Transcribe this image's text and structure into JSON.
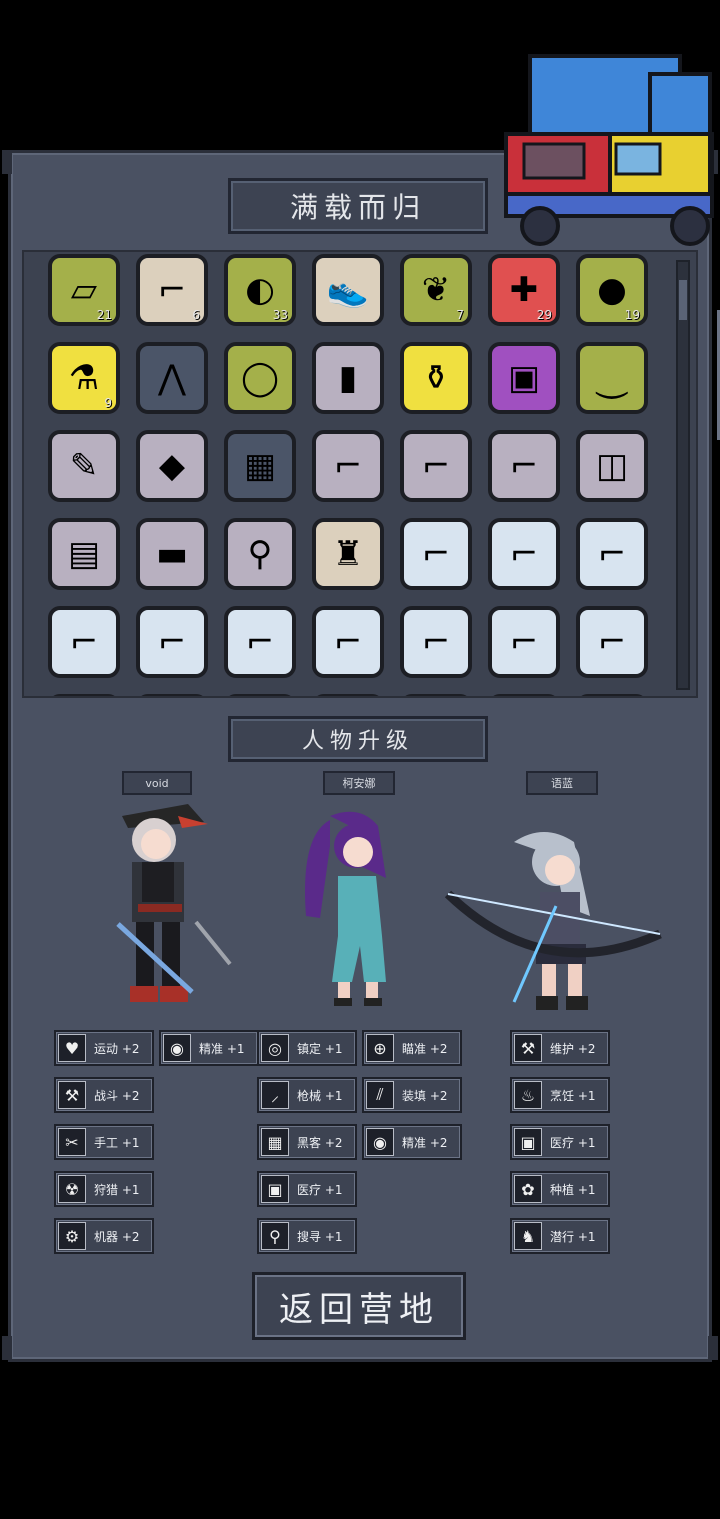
{
  "top_title": "满载而归",
  "upgrade_title": "人物升级",
  "return_button": "返回营地",
  "inventory": [
    {
      "icon": "tissue-icon",
      "glyph": "▱",
      "bg": "#a4b04a",
      "count": "21"
    },
    {
      "icon": "rifle-icon",
      "glyph": "⌐",
      "bg": "#dcd0bd",
      "count": "6"
    },
    {
      "icon": "meat-can-icon",
      "glyph": "◐",
      "bg": "#a4b04a",
      "count": "33"
    },
    {
      "icon": "sneaker-icon",
      "glyph": "👟",
      "bg": "#dcd0bd",
      "count": ""
    },
    {
      "icon": "herb-icon",
      "glyph": "❦",
      "bg": "#a4b04a",
      "count": "7"
    },
    {
      "icon": "medkit-icon",
      "glyph": "✚",
      "bg": "#e05050",
      "count": "29"
    },
    {
      "icon": "egg-icon",
      "glyph": "●",
      "bg": "#a4b04a",
      "count": "19"
    },
    {
      "icon": "potion-icon",
      "glyph": "⚗",
      "bg": "#f0e040",
      "count": "9"
    },
    {
      "icon": "pants-icon",
      "glyph": "⋀",
      "bg": "#4b5568",
      "count": ""
    },
    {
      "icon": "ring-icon",
      "glyph": "◯",
      "bg": "#a4b04a",
      "count": ""
    },
    {
      "icon": "manual-icon",
      "glyph": "▮",
      "bg": "#b8b0c0",
      "count": ""
    },
    {
      "icon": "bottle-icon",
      "glyph": "⚱",
      "bg": "#f0e040",
      "count": ""
    },
    {
      "icon": "battery-icon",
      "glyph": "▣",
      "bg": "#a050c0",
      "count": ""
    },
    {
      "icon": "socks-icon",
      "glyph": "⏝",
      "bg": "#a4b04a",
      "count": ""
    },
    {
      "icon": "blueprint-icon",
      "glyph": "✎",
      "bg": "#b8b0c0",
      "count": ""
    },
    {
      "icon": "recipe-book-icon",
      "glyph": "◆",
      "bg": "#b8b0c0",
      "count": ""
    },
    {
      "icon": "camo-vest-icon",
      "glyph": "▦",
      "bg": "#4b5568",
      "count": ""
    },
    {
      "icon": "gun-icon",
      "glyph": "⌐",
      "bg": "#b8b0c0",
      "count": ""
    },
    {
      "icon": "gun-icon",
      "glyph": "⌐",
      "bg": "#b8b0c0",
      "count": ""
    },
    {
      "icon": "gun-icon",
      "glyph": "⌐",
      "bg": "#b8b0c0",
      "count": ""
    },
    {
      "icon": "goggles-icon",
      "glyph": "◫",
      "bg": "#b8b0c0",
      "count": ""
    },
    {
      "icon": "notebook-icon",
      "glyph": "▤",
      "bg": "#b8b0c0",
      "count": ""
    },
    {
      "icon": "blade-icon",
      "glyph": "▬",
      "bg": "#b8b0c0",
      "count": ""
    },
    {
      "icon": "search-book-icon",
      "glyph": "⚲",
      "bg": "#b8b0c0",
      "count": ""
    },
    {
      "icon": "jacket-icon",
      "glyph": "♜",
      "bg": "#dcd0bd",
      "count": ""
    },
    {
      "icon": "plasma-gun-icon",
      "glyph": "⌐",
      "bg": "#d8e4f0",
      "count": ""
    },
    {
      "icon": "plasma-gun-icon",
      "glyph": "⌐",
      "bg": "#d8e4f0",
      "count": ""
    },
    {
      "icon": "plasma-gun-icon",
      "glyph": "⌐",
      "bg": "#d8e4f0",
      "count": ""
    },
    {
      "icon": "plasma-gun-icon",
      "glyph": "⌐",
      "bg": "#d8e4f0",
      "count": ""
    },
    {
      "icon": "plasma-gun-icon",
      "glyph": "⌐",
      "bg": "#d8e4f0",
      "count": ""
    },
    {
      "icon": "plasma-gun-icon",
      "glyph": "⌐",
      "bg": "#d8e4f0",
      "count": ""
    },
    {
      "icon": "plasma-gun-icon",
      "glyph": "⌐",
      "bg": "#d8e4f0",
      "count": ""
    },
    {
      "icon": "plasma-gun-icon",
      "glyph": "⌐",
      "bg": "#d8e4f0",
      "count": ""
    },
    {
      "icon": "plasma-gun-icon",
      "glyph": "⌐",
      "bg": "#d8e4f0",
      "count": ""
    },
    {
      "icon": "plasma-gun-icon",
      "glyph": "⌐",
      "bg": "#d8e4f0",
      "count": ""
    },
    {
      "icon": "plasma-gun-icon",
      "glyph": "",
      "bg": "#d8e4f0",
      "count": ""
    },
    {
      "icon": "plasma-gun-icon",
      "glyph": "",
      "bg": "#d8e4f0",
      "count": ""
    },
    {
      "icon": "plasma-gun-icon",
      "glyph": "",
      "bg": "#d8e4f0",
      "count": ""
    },
    {
      "icon": "plasma-gun-icon",
      "glyph": "",
      "bg": "#d8e4f0",
      "count": ""
    },
    {
      "icon": "plasma-gun-icon",
      "glyph": "",
      "bg": "#d8e4f0",
      "count": ""
    },
    {
      "icon": "plasma-gun-icon",
      "glyph": "",
      "bg": "#d8e4f0",
      "count": ""
    },
    {
      "icon": "plasma-gun-icon",
      "glyph": "",
      "bg": "#d8e4f0",
      "count": ""
    }
  ],
  "characters": [
    {
      "name": "void"
    },
    {
      "name": "柯安娜"
    },
    {
      "name": "语蓝"
    }
  ],
  "skills": {
    "col1": [
      {
        "icon": "heart-icon",
        "glyph": "♥",
        "label": "运动 +2"
      },
      {
        "icon": "wrench-icon",
        "glyph": "⚒",
        "label": "战斗 +2"
      },
      {
        "icon": "scissors-icon",
        "glyph": "✂",
        "label": "手工 +1"
      },
      {
        "icon": "radiation-icon",
        "glyph": "☢",
        "label": "狩猎 +1"
      },
      {
        "icon": "gear-icon",
        "glyph": "⚙",
        "label": "机器 +2"
      }
    ],
    "col2": [
      {
        "icon": "eye-icon",
        "glyph": "◉",
        "label": "精准 +1"
      }
    ],
    "col3": [
      {
        "icon": "goggles-icon",
        "glyph": "◎",
        "label": "镇定 +1"
      },
      {
        "icon": "knife-icon",
        "glyph": "⸝",
        "label": "枪械 +1"
      },
      {
        "icon": "circuit-icon",
        "glyph": "▦",
        "label": "黑客 +2"
      },
      {
        "icon": "medical-icon",
        "glyph": "▣",
        "label": "医疗 +1"
      },
      {
        "icon": "magnifier-icon",
        "glyph": "⚲",
        "label": "搜寻 +1"
      }
    ],
    "col4": [
      {
        "icon": "crosshair-icon",
        "glyph": "⊕",
        "label": "瞄准 +2"
      },
      {
        "icon": "claw-icon",
        "glyph": "⫽",
        "label": "装填 +2"
      },
      {
        "icon": "eye-icon",
        "glyph": "◉",
        "label": "精准 +2"
      }
    ],
    "col5": [
      {
        "icon": "wrench-icon",
        "glyph": "⚒",
        "label": "维护 +2"
      },
      {
        "icon": "pot-icon",
        "glyph": "♨",
        "label": "烹饪 +1"
      },
      {
        "icon": "medical-icon",
        "glyph": "▣",
        "label": "医疗 +1"
      },
      {
        "icon": "plant-icon",
        "glyph": "✿",
        "label": "种植 +1"
      },
      {
        "icon": "stealth-icon",
        "glyph": "♞",
        "label": "潜行 +1"
      }
    ]
  }
}
